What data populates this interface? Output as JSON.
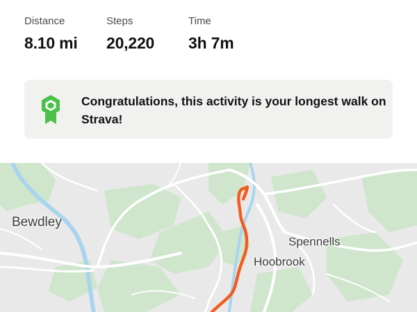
{
  "stats": {
    "distance": {
      "label": "Distance",
      "value": "8.10 mi"
    },
    "steps": {
      "label": "Steps",
      "value": "20,220"
    },
    "time": {
      "label": "Time",
      "value": "3h 7m"
    }
  },
  "achievement": {
    "icon": "award-badge-icon",
    "message": "Congratulations, this activity is your longest walk on Strava!",
    "accent_color": "#4cc14a"
  },
  "map": {
    "labels": {
      "town_west": "Bewdley",
      "area_east": "Spennells",
      "area_center": "Hoobrook"
    },
    "route_color": "#f25c1f",
    "water_color": "#a8d4ee",
    "green_color": "#cfe6cd"
  }
}
